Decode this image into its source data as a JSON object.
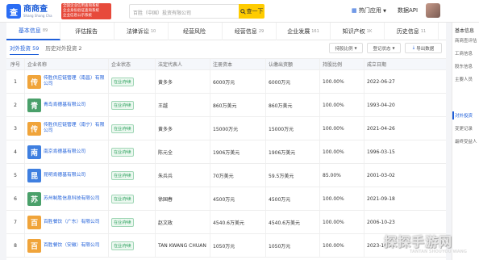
{
  "topbar": {
    "logo_mark": "查",
    "logo_name": "商商查",
    "logo_sub": "Shang Shang Cha",
    "promo_lines": [
      "全国企业信用查询系统",
      "企业身份验证查询系统",
      "企业信息公示系统"
    ],
    "search_value": "百胜（中国）投资有限公司",
    "search_button": "查一下",
    "hot_apps": "热门应用",
    "data_api": "数据API"
  },
  "tabs": [
    {
      "label": "基本信息",
      "count": "89",
      "active": true
    },
    {
      "label": "评估报告",
      "count": "",
      "active": false
    },
    {
      "label": "法律诉讼",
      "count": "10",
      "active": false
    },
    {
      "label": "经营风险",
      "count": "",
      "active": false
    },
    {
      "label": "经营信息",
      "count": "29",
      "active": false
    },
    {
      "label": "企业发展",
      "count": "161",
      "active": false
    },
    {
      "label": "知识产权",
      "count": "1K",
      "active": false
    },
    {
      "label": "历史信息",
      "count": "11",
      "active": false
    }
  ],
  "subtabs": [
    {
      "label": "对外投资 59",
      "active": true
    },
    {
      "label": "历史对外投资 2",
      "active": false
    }
  ],
  "filters": {
    "ratio": "持股比例",
    "status": "登记状态",
    "export": "导出数据"
  },
  "table": {
    "headers": [
      "序号",
      "企业名称",
      "企业状态",
      "法定代表人",
      "注册资本",
      "认缴出资额",
      "持股比例",
      "成立日期"
    ],
    "rows": [
      {
        "no": "1",
        "logo": "传",
        "color": "#f0a43a",
        "name": "传胜供应链管理（南昌）有限公司",
        "status": "在业/存续",
        "rep": "黄多多",
        "capital": "6000万元",
        "subscribed": "6000万元",
        "ratio": "100.00%",
        "date": "2022-06-27"
      },
      {
        "no": "2",
        "logo": "青",
        "color": "#4aa06a",
        "name": "青岛肯德基有限公司",
        "status": "在业/存续",
        "rep": "王越",
        "capital": "860万美元",
        "subscribed": "860万美元",
        "ratio": "100.00%",
        "date": "1993-04-20"
      },
      {
        "no": "3",
        "logo": "传",
        "color": "#f0a43a",
        "name": "传胜供应链管理（南宁）有限公司",
        "status": "在业/存续",
        "rep": "黄多多",
        "capital": "15000万元",
        "subscribed": "15000万元",
        "ratio": "100.00%",
        "date": "2021-04-26"
      },
      {
        "no": "4",
        "logo": "南",
        "color": "#3f7fe0",
        "name": "南京肯德基有限公司",
        "status": "在业/存续",
        "rep": "陈元全",
        "capital": "1906万美元",
        "subscribed": "1906万美元",
        "ratio": "100.00%",
        "date": "1996-03-15"
      },
      {
        "no": "5",
        "logo": "昆",
        "color": "#3f7fe0",
        "name": "昆明肯德基有限公司",
        "status": "在业/存续",
        "rep": "朱兵兵",
        "capital": "70万美元",
        "subscribed": "59.5万美元",
        "ratio": "85.00%",
        "date": "2001-03-02"
      },
      {
        "no": "6",
        "logo": "苏",
        "color": "#4aa06a",
        "name": "苏州制胜信息科技有限公司",
        "status": "在业/存续",
        "rep": "徐国春",
        "capital": "4500万元",
        "subscribed": "4500万元",
        "ratio": "100.00%",
        "date": "2021-09-18"
      },
      {
        "no": "7",
        "logo": "百",
        "color": "#f0a43a",
        "name": "百胜餐饮（广东）有限公司",
        "status": "在业/存续",
        "rep": "赵文政",
        "capital": "4540.6万美元",
        "subscribed": "4540.6万美元",
        "ratio": "100.00%",
        "date": "2006-10-23"
      },
      {
        "no": "8",
        "logo": "百",
        "color": "#f0a43a",
        "name": "百胜餐饮（安徽）有限公司",
        "status": "在业/存续",
        "rep": "TAN KWANG CHUAN",
        "capital": "1050万元",
        "subscribed": "1050万元",
        "ratio": "100.00%",
        "date": "2023-10-20"
      }
    ]
  },
  "rightnav": {
    "title": "基本信息",
    "items": [
      "商商查评估",
      "工商信息",
      "股东信息",
      "主要人员",
      "对外投资",
      "变更记录",
      "最终受益人"
    ],
    "active_index": 4
  },
  "watermark": {
    "text": "探探手游网",
    "sub": "TANTAN SHOUYOU WANG"
  }
}
